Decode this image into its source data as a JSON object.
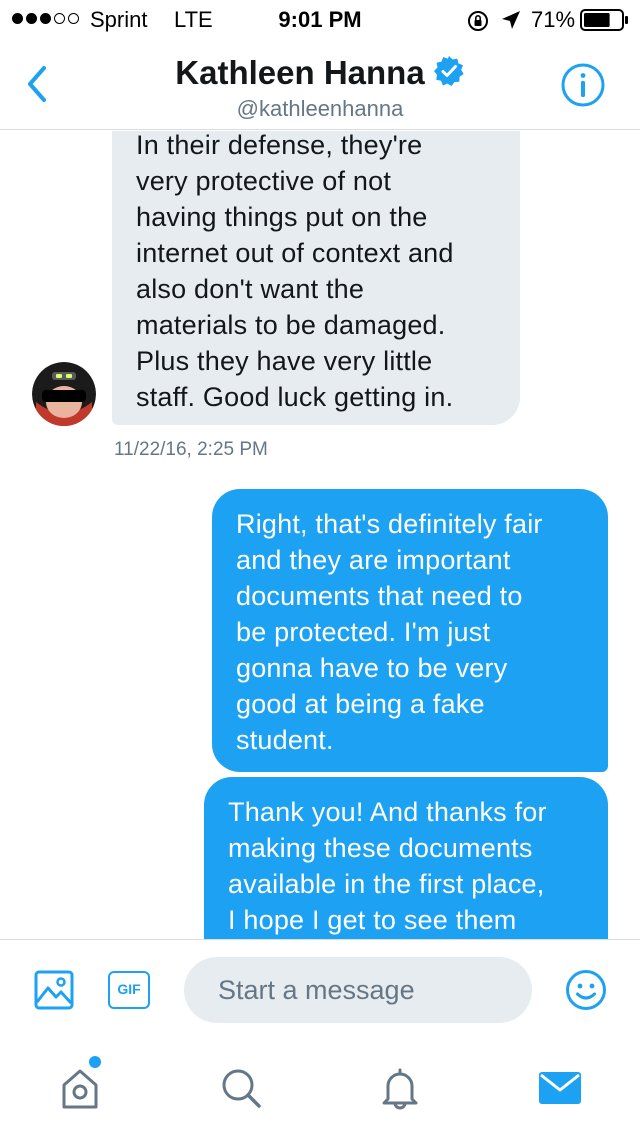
{
  "status_bar": {
    "carrier": "Sprint",
    "network": "LTE",
    "time": "9:01 PM",
    "battery": "71%",
    "signal_bars_filled": 3,
    "signal_bars_total": 5,
    "battery_level": 0.71
  },
  "header": {
    "name": "Kathleen Hanna",
    "handle": "@kathleenhanna",
    "verified": true,
    "icons": {
      "back": "chevron-left-icon",
      "verified": "verified-badge-icon",
      "info": "info-icon"
    }
  },
  "messages": [
    {
      "direction": "received",
      "lines": [
        "In their defense, they're",
        "very protective of not",
        "having things put on the",
        "internet out of context and",
        "also don't want the",
        "materials to be damaged.",
        "Plus they have very little",
        "staff. Good luck getting in."
      ],
      "timestamp": "11/22/16, 2:25 PM"
    },
    {
      "direction": "sent",
      "lines": [
        "Right, that's definitely fair",
        "and they are important",
        "documents that need to",
        "be protected. I'm just",
        "gonna have to be very",
        "good at being a fake",
        "student."
      ]
    },
    {
      "direction": "sent",
      "lines": [
        "Thank you! And thanks for",
        "making these documents",
        "available in the first place,",
        "I hope I get to see them"
      ]
    }
  ],
  "composer": {
    "placeholder": "Start a message",
    "gif_label": "GIF",
    "icons": {
      "image": "image-icon",
      "emoji": "emoji-icon"
    }
  },
  "tab_bar": {
    "tabs": [
      {
        "name": "home",
        "icon": "home-icon",
        "has_notification_dot": true
      },
      {
        "name": "search",
        "icon": "search-icon"
      },
      {
        "name": "notifications",
        "icon": "bell-icon"
      },
      {
        "name": "messages",
        "icon": "mail-icon",
        "active": true
      }
    ]
  },
  "colors": {
    "accent": "#1da1f2",
    "received_bubble": "#e6ecf0",
    "secondary_text": "#657786",
    "inactive_icon": "#657786"
  }
}
